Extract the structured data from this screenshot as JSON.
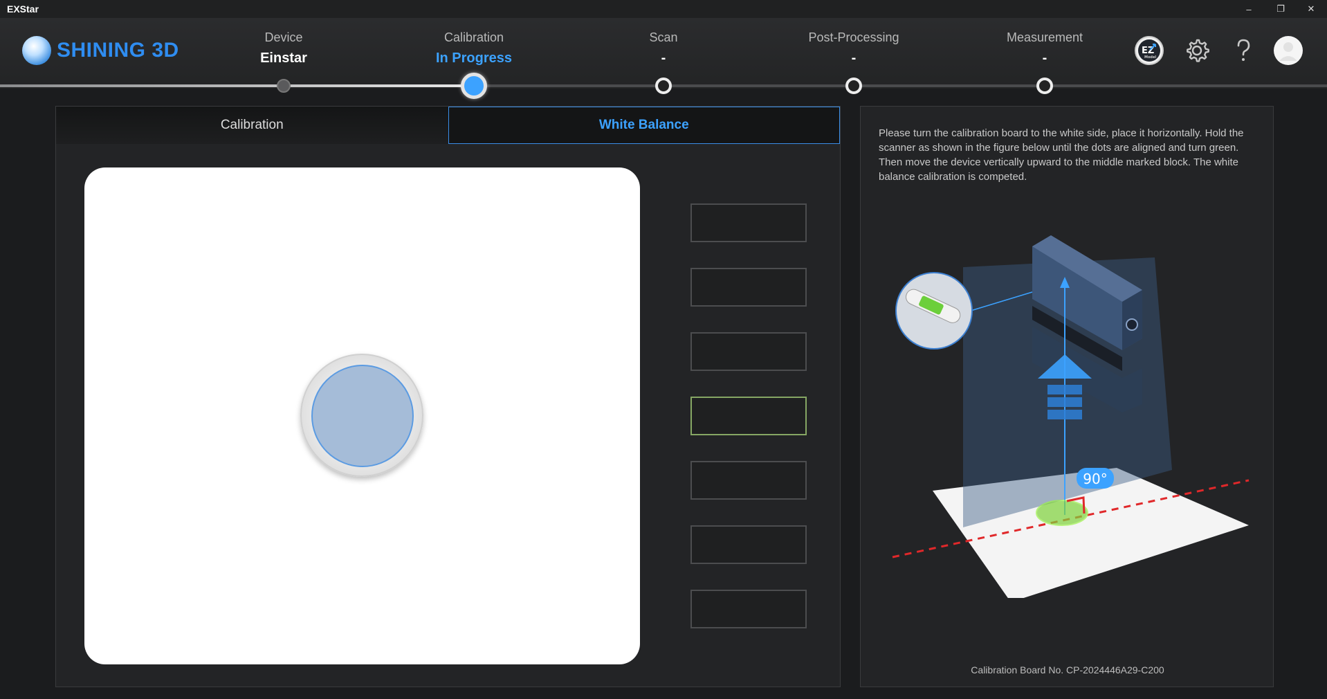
{
  "window": {
    "title": "EXStar",
    "minimize": "–",
    "maximize": "❐",
    "close": "✕"
  },
  "brand": {
    "name": "SHINING 3D",
    "accent": "#2f8df1"
  },
  "steps": [
    {
      "label": "Device",
      "value": "Einstar",
      "state": "done"
    },
    {
      "label": "Calibration",
      "value": "In Progress",
      "state": "active"
    },
    {
      "label": "Scan",
      "value": "-",
      "state": "todo"
    },
    {
      "label": "Post-Processing",
      "value": "-",
      "state": "todo"
    },
    {
      "label": "Measurement",
      "value": "-",
      "state": "todo"
    }
  ],
  "header_icons": {
    "ez_badge": "EZ",
    "model_label": "Model"
  },
  "tabs": [
    {
      "label": "Calibration",
      "selected": false
    },
    {
      "label": "White Balance",
      "selected": true
    }
  ],
  "distance_levels": {
    "count": 7,
    "current_index": 3
  },
  "instructions": "Please turn the calibration board to the white side, place it horizontally. Hold the scanner as shown in the figure below until the dots are aligned and turn green. Then move the device vertically upward to the middle marked block. The white balance calibration is competed.",
  "illustration": {
    "angle_label": "90°"
  },
  "calibration_board": "Calibration Board No. CP-2024446A29-C200",
  "colors": {
    "active": "#3ca2ff",
    "ok_green": "#86a764",
    "guide_red": "#e0282a"
  }
}
